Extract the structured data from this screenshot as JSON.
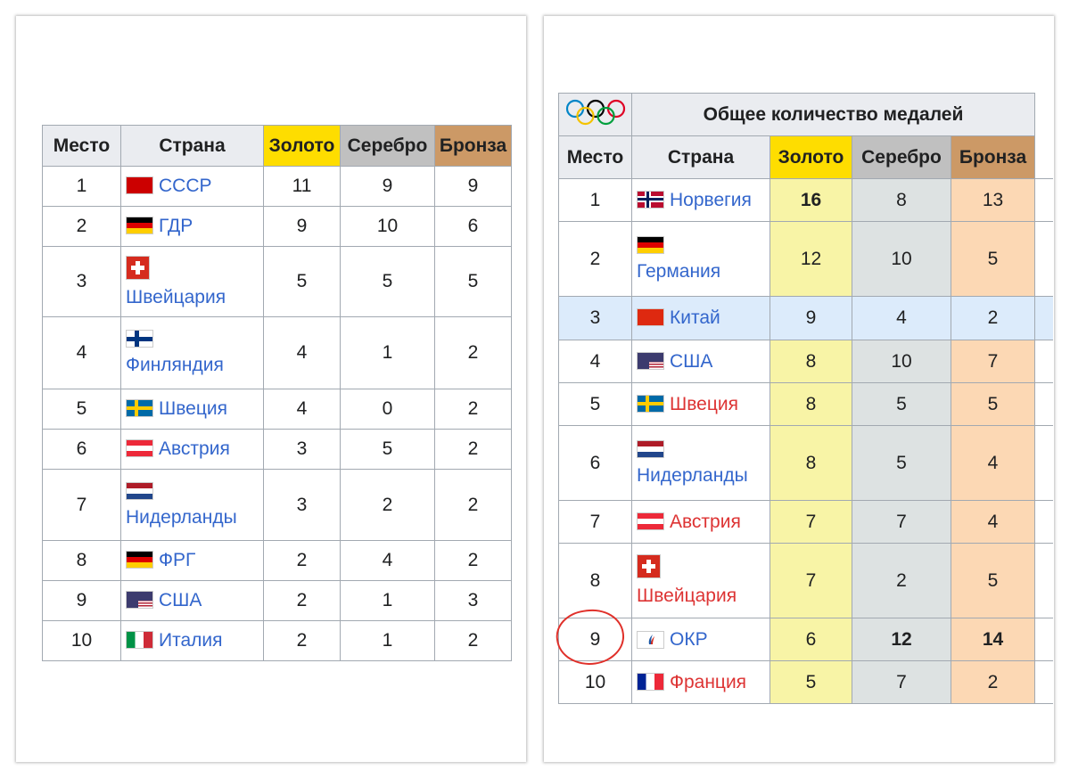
{
  "left_table": {
    "headers": {
      "place": "Место",
      "country": "Страна",
      "gold": "Золото",
      "silver": "Серебро",
      "bronze": "Бронза"
    },
    "rows": [
      {
        "place": "1",
        "country": "СССР",
        "flag": "ussr",
        "gold": "11",
        "silver": "9",
        "bronze": "9",
        "wrap": false
      },
      {
        "place": "2",
        "country": "ГДР",
        "flag": "gdr",
        "gold": "9",
        "silver": "10",
        "bronze": "6",
        "wrap": false
      },
      {
        "place": "3",
        "country": "Швейцария",
        "flag": "switzerland",
        "gold": "5",
        "silver": "5",
        "bronze": "5",
        "wrap": true
      },
      {
        "place": "4",
        "country": "Финляндия",
        "flag": "finland",
        "gold": "4",
        "silver": "1",
        "bronze": "2",
        "wrap": true
      },
      {
        "place": "5",
        "country": "Швеция",
        "flag": "sweden",
        "gold": "4",
        "silver": "0",
        "bronze": "2",
        "wrap": false
      },
      {
        "place": "6",
        "country": "Австрия",
        "flag": "austria",
        "gold": "3",
        "silver": "5",
        "bronze": "2",
        "wrap": false
      },
      {
        "place": "7",
        "country": "Нидерланды",
        "flag": "netherlands",
        "gold": "3",
        "silver": "2",
        "bronze": "2",
        "wrap": true
      },
      {
        "place": "8",
        "country": "ФРГ",
        "flag": "germany",
        "gold": "2",
        "silver": "4",
        "bronze": "2",
        "wrap": false
      },
      {
        "place": "9",
        "country": "США",
        "flag": "usa",
        "gold": "2",
        "silver": "1",
        "bronze": "3",
        "wrap": false
      },
      {
        "place": "10",
        "country": "Италия",
        "flag": "italy",
        "gold": "2",
        "silver": "1",
        "bronze": "2",
        "wrap": false
      }
    ]
  },
  "right_table": {
    "title": "Общее количество медалей",
    "logo_icon": "olympic-rings",
    "headers": {
      "place": "Место",
      "country": "Страна",
      "gold": "Золото",
      "silver": "Серебро",
      "bronze": "Бронза"
    },
    "rows": [
      {
        "place": "1",
        "country": "Норвегия",
        "flag": "norway",
        "gold": "16",
        "silver": "8",
        "bronze": "13",
        "wrap": false,
        "red": false,
        "bold": [
          "gold"
        ]
      },
      {
        "place": "2",
        "country": "Германия",
        "flag": "germany",
        "gold": "12",
        "silver": "10",
        "bronze": "5",
        "wrap": true,
        "red": false,
        "bold": []
      },
      {
        "place": "3",
        "country": "Китай",
        "flag": "china",
        "gold": "9",
        "silver": "4",
        "bronze": "2",
        "wrap": false,
        "red": false,
        "bold": [],
        "highlight": true
      },
      {
        "place": "4",
        "country": "США",
        "flag": "usa",
        "gold": "8",
        "silver": "10",
        "bronze": "7",
        "wrap": false,
        "red": false,
        "bold": []
      },
      {
        "place": "5",
        "country": "Швеция",
        "flag": "sweden",
        "gold": "8",
        "silver": "5",
        "bronze": "5",
        "wrap": false,
        "red": true,
        "bold": []
      },
      {
        "place": "6",
        "country": "Нидерланды",
        "flag": "netherlands",
        "gold": "8",
        "silver": "5",
        "bronze": "4",
        "wrap": true,
        "red": false,
        "bold": []
      },
      {
        "place": "7",
        "country": "Австрия",
        "flag": "austria",
        "gold": "7",
        "silver": "7",
        "bronze": "4",
        "wrap": false,
        "red": true,
        "bold": []
      },
      {
        "place": "8",
        "country": "Швейцария",
        "flag": "switzerland",
        "gold": "7",
        "silver": "2",
        "bronze": "5",
        "wrap": true,
        "red": true,
        "bold": []
      },
      {
        "place": "9",
        "country": "ОКР",
        "flag": "roc",
        "gold": "6",
        "silver": "12",
        "bronze": "14",
        "wrap": false,
        "red": false,
        "bold": [
          "silver",
          "bronze"
        ],
        "circled": true
      },
      {
        "place": "10",
        "country": "Франция",
        "flag": "france",
        "gold": "5",
        "silver": "7",
        "bronze": "2",
        "wrap": false,
        "red": true,
        "bold": []
      }
    ]
  },
  "colors": {
    "gold": "#fedd00",
    "silver": "#c0c0c0",
    "bronze": "#cc9966",
    "link": "#3366cc",
    "redlink": "#dd3333",
    "annotation": "#e0302a"
  }
}
